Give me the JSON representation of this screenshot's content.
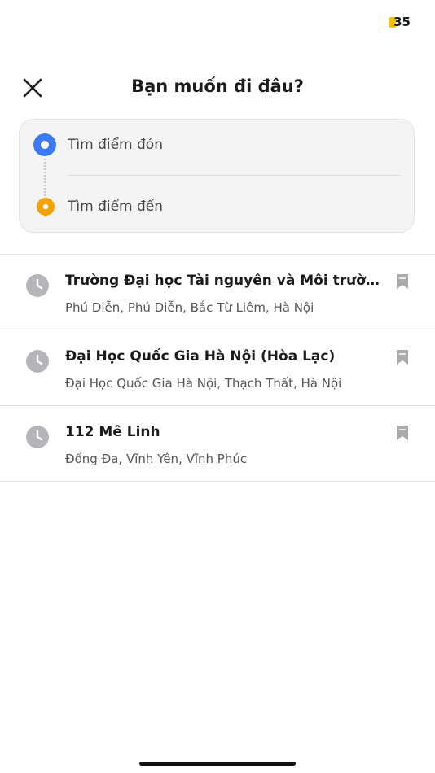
{
  "status_bar": {
    "battery_level": "35",
    "battery_color": "#f7c500"
  },
  "header": {
    "title": "Bạn muốn đi đâu?",
    "close_icon": "close-icon"
  },
  "search": {
    "pickup_placeholder": "Tìm điểm đón",
    "destination_placeholder": "Tìm điểm đến",
    "pickup_color": "#3d7bf5",
    "destination_color": "#f5a200"
  },
  "history": [
    {
      "name": "Trường Đại học Tài nguyên và Môi trường Hà Nội",
      "address": "Phú Diễn, Phú Diễn, Bắc Từ Liêm, Hà Nội",
      "icon": "clock-icon"
    },
    {
      "name": "Đại Học Quốc Gia Hà Nội (Hòa Lạc)",
      "address": "Đại Học Quốc Gia Hà Nội, Thạch Thất, Hà Nội",
      "icon": "clock-icon"
    },
    {
      "name": "112 Mê Linh",
      "address": "Đống Đa, Vĩnh Yên, Vĩnh Phúc",
      "icon": "clock-icon"
    }
  ]
}
